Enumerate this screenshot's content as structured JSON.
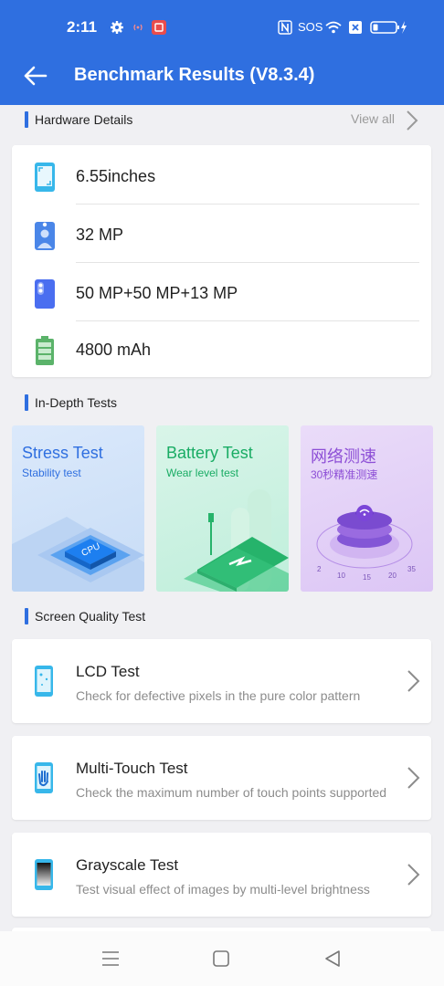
{
  "status_bar": {
    "time": "2:11",
    "sos": "SOS"
  },
  "app_bar": {
    "title": "Benchmark Results (V8.3.4)"
  },
  "hardware": {
    "section_title": "Hardware Details",
    "view_all": "View all",
    "items": [
      {
        "icon": "screen-icon",
        "value": "6.55inches"
      },
      {
        "icon": "front-camera-icon",
        "value": "32 MP"
      },
      {
        "icon": "rear-camera-icon",
        "value": "50 MP+50 MP+13 MP"
      },
      {
        "icon": "battery-icon",
        "value": "4800 mAh"
      }
    ]
  },
  "in_depth": {
    "section_title": "In-Depth Tests",
    "tiles": [
      {
        "title": "Stress Test",
        "subtitle": "Stability test",
        "badge": "CPU"
      },
      {
        "title": "Battery Test",
        "subtitle": "Wear level test"
      },
      {
        "title": "网络测速",
        "subtitle": "30秒精准测速",
        "scale": [
          "2",
          "10",
          "15",
          "20",
          "35"
        ]
      }
    ]
  },
  "screen_quality": {
    "section_title": "Screen Quality Test",
    "items": [
      {
        "icon": "lcd-phone-icon",
        "title": "LCD Test",
        "desc": "Check for defective pixels in the pure color pattern"
      },
      {
        "icon": "multi-touch-phone-icon",
        "title": "Multi-Touch Test",
        "desc": "Check the maximum number of touch points supported"
      },
      {
        "icon": "grayscale-phone-icon",
        "title": "Grayscale Test",
        "desc": "Test visual effect of images by multi-level brightness"
      }
    ]
  },
  "colors": {
    "primary": "#2f6fe0",
    "background": "#f0f0f3"
  }
}
